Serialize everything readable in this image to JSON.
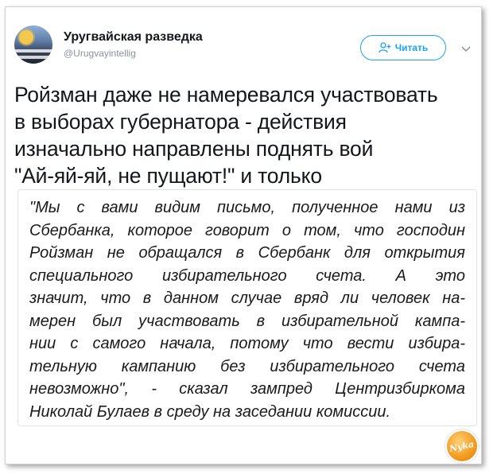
{
  "author": {
    "display_name": "Уругвайская разведка",
    "handle": "@Urugvayintellig",
    "avatar_icon": "avatar-uruguay-sun"
  },
  "follow_button": {
    "label": "Читать",
    "icon": "add-person-icon",
    "color": "#1da1f2"
  },
  "menu_icon": "chevron-down-icon",
  "tweet_lines": [
    "Ройзман даже не намеревался участвовать",
    "в выборах губернатора - действия",
    "изначально направлены  поднять вой",
    "\"Ай-яй-яй, не пущают!\" и только"
  ],
  "quote_lines": [
    "\"Мы с вами видим письмо, полученное нами из",
    "Сбербанка, которое говорит о том, что господин",
    "Ройзман не обращался в Сбербанк для открытия",
    "специального избирательного счета. А это",
    "значит, что в данном случае вряд ли человек на-",
    "мерен был участвовать в избирательной кампа-",
    "нии с самого начала, потому что вести избира-",
    "тельную кампанию без избирательного счета",
    "невозможно\", - сказал зампред Центризбиркома",
    "Николай Булаев в среду на заседании комиссии."
  ],
  "watermark": {
    "text": "Nyka"
  }
}
